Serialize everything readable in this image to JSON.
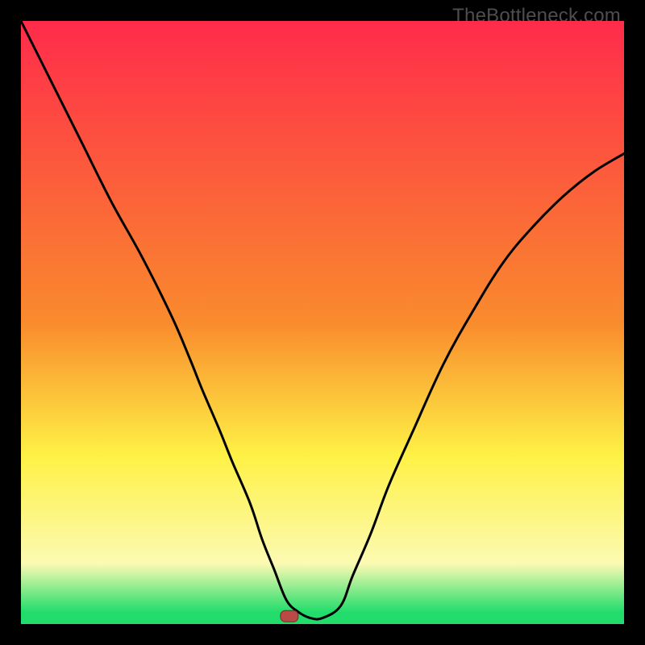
{
  "watermark": "TheBottleneck.com",
  "colors": {
    "grad_top": "#ff2b4b",
    "grad_mid_orange": "#f98b2d",
    "grad_yellow": "#fef145",
    "grad_pale_yellow": "#fcfab3",
    "grad_green": "#22dd6b",
    "curve_stroke": "#000000",
    "marker_fill": "#b94a45",
    "marker_stroke": "#7a2c28",
    "frame_bg": "#000000"
  },
  "chart_data": {
    "type": "line",
    "title": "",
    "xlabel": "",
    "ylabel": "",
    "xlim": [
      0,
      100
    ],
    "ylim": [
      0,
      100
    ],
    "grid": false,
    "legend": false,
    "notes": "V-shaped bottleneck curve on a vertical red→yellow→green gradient. No axes/ticks/labels are rendered in the image; x/y values are estimated as 0–100 normalized positions read from the plot area.",
    "series": [
      {
        "name": "bottleneck-curve",
        "x": [
          0,
          5,
          10,
          15,
          20,
          25,
          28,
          30,
          33,
          35,
          38,
          40,
          42,
          44,
          46,
          48,
          50,
          53,
          55,
          58,
          61,
          65,
          70,
          75,
          80,
          85,
          90,
          95,
          100
        ],
        "y": [
          100,
          90,
          80,
          70,
          61,
          51,
          44,
          39,
          32,
          27,
          20,
          14,
          9,
          4,
          2,
          1,
          1,
          3,
          8,
          15,
          23,
          32,
          43,
          52,
          60,
          66,
          71,
          75,
          78
        ]
      }
    ],
    "marker": {
      "x": 44.5,
      "y": 1.3,
      "shape": "rounded-rect"
    },
    "gradient_stops_pct": [
      {
        "offset": 0,
        "color_key": "grad_top"
      },
      {
        "offset": 50,
        "color_key": "grad_mid_orange"
      },
      {
        "offset": 72,
        "color_key": "grad_yellow"
      },
      {
        "offset": 90,
        "color_key": "grad_pale_yellow"
      },
      {
        "offset": 98,
        "color_key": "grad_green"
      }
    ]
  }
}
